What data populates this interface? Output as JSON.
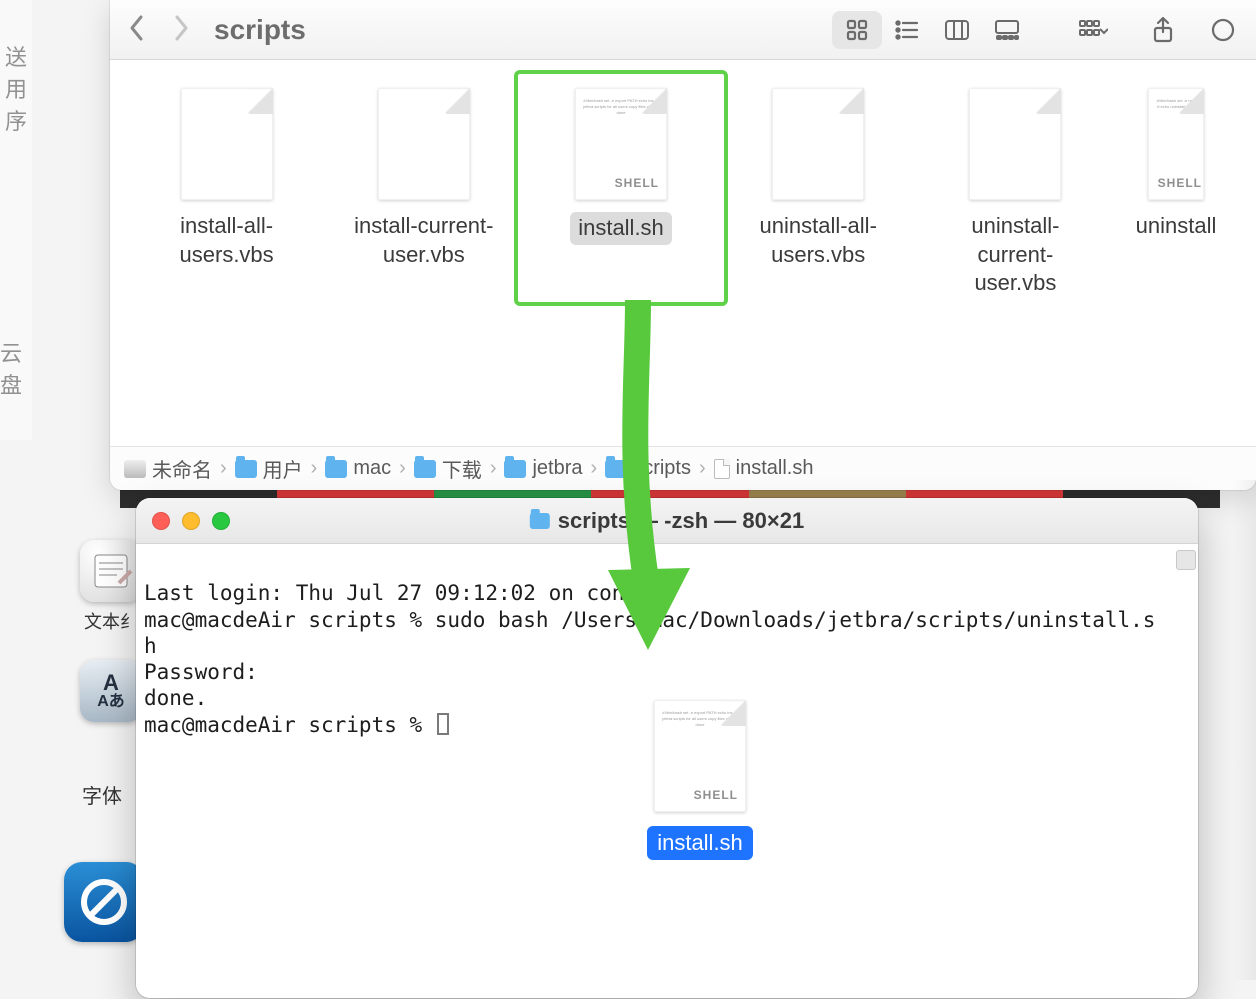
{
  "sidebar_fragments": [
    "送",
    "用",
    "序",
    "云盘"
  ],
  "finder": {
    "title": "scripts",
    "files": [
      {
        "name": "install-all-users.vbs",
        "kind": "generic"
      },
      {
        "name": "install-current-user.vbs",
        "kind": "generic"
      },
      {
        "name": "install.sh",
        "kind": "shell",
        "selected": true,
        "shell_tag": "SHELL"
      },
      {
        "name": "uninstall-all-users.vbs",
        "kind": "generic"
      },
      {
        "name": "uninstall-current-user.vbs",
        "kind": "generic"
      },
      {
        "name": "uninstall",
        "kind": "shell",
        "cropped": true,
        "shell_tag": "SHELL"
      }
    ],
    "path": [
      {
        "label": "未命名",
        "icon": "disk"
      },
      {
        "label": "用户",
        "icon": "folder"
      },
      {
        "label": "mac",
        "icon": "folder"
      },
      {
        "label": "下载",
        "icon": "folder"
      },
      {
        "label": "jetbra",
        "icon": "folder",
        "truncated": true
      },
      {
        "label": "scripts",
        "icon": "folder"
      },
      {
        "label": "install.sh",
        "icon": "doc"
      }
    ]
  },
  "desktop": {
    "textedit_label": "文本纟",
    "font_glyph_top": "A",
    "font_glyph_bottom": "Aあ",
    "font_label": "字体"
  },
  "terminal": {
    "title": "scripts — -zsh — 80×21",
    "lines": [
      "Last login: Thu Jul 27 09:12:02 on console",
      "mac@macdeAir scripts % sudo bash /Users/mac/Downloads/jetbra/scripts/uninstall.s",
      "h",
      "Password:",
      "done.",
      "mac@macdeAir scripts % "
    ]
  },
  "drag": {
    "label": "install.sh",
    "shell_tag": "SHELL"
  }
}
